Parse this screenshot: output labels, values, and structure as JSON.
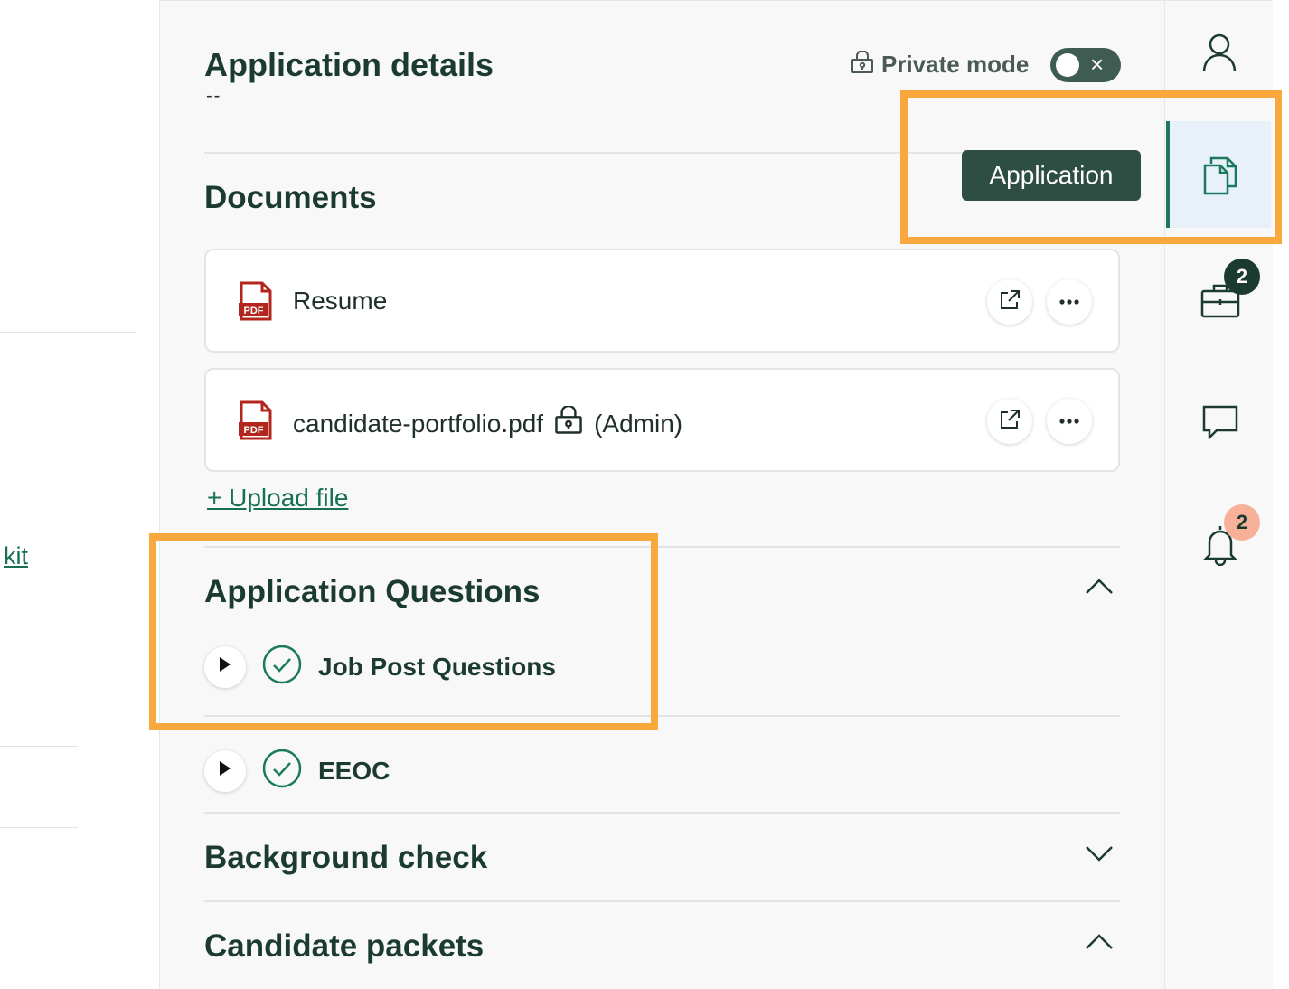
{
  "left": {
    "link_text": "kit"
  },
  "header": {
    "title": "Application details",
    "subtitle": "--",
    "private_mode_label": "Private mode",
    "private_mode_on": false
  },
  "documents": {
    "heading": "Documents",
    "files": [
      {
        "name": "Resume",
        "suffix": "",
        "private": false
      },
      {
        "name": "candidate-portfolio.pdf",
        "suffix": "(Admin)",
        "private": true
      }
    ],
    "upload_label": "+ Upload file"
  },
  "sections": {
    "application_questions": {
      "heading": "Application Questions",
      "expanded": true,
      "items": [
        {
          "label": "Job Post Questions",
          "status": "complete"
        },
        {
          "label": "EEOC",
          "status": "complete"
        }
      ]
    },
    "background_check": {
      "heading": "Background check",
      "expanded": false
    },
    "candidate_packets": {
      "heading": "Candidate packets",
      "expanded": true
    }
  },
  "rail": {
    "tooltip": "Application",
    "active": "application",
    "jobs_badge": "2",
    "notifications_badge": "2"
  },
  "colors": {
    "brand_green": "#1b7a5e",
    "tooltip_bg": "#2e4d43",
    "highlight": "#f8a83c",
    "badge_dark": "#1c3b30",
    "badge_peach": "#f7b199"
  }
}
